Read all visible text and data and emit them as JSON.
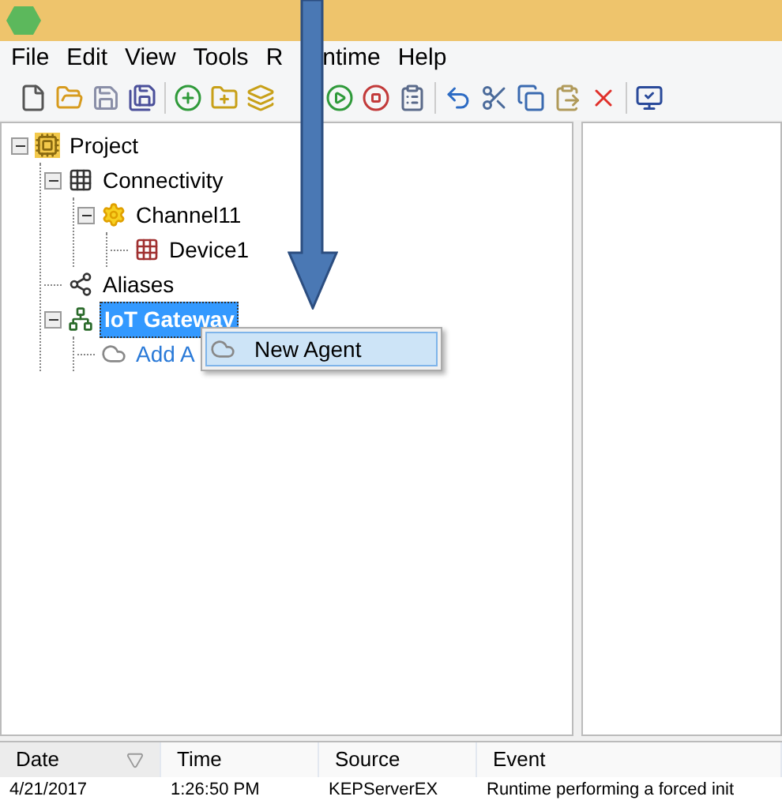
{
  "menu": [
    {
      "label": "File"
    },
    {
      "label": "Edit"
    },
    {
      "label": "View"
    },
    {
      "label": "Tools"
    },
    {
      "label": "R",
      "label_rest": "ntime"
    },
    {
      "label": "Help"
    }
  ],
  "tree": [
    {
      "label": "Project",
      "kind": "project",
      "expanded": true,
      "selected": false,
      "children": [
        {
          "label": "Connectivity",
          "kind": "connectivity",
          "expanded": true,
          "selected": false,
          "children": [
            {
              "label": "Channel11",
              "kind": "channel",
              "expanded": true,
              "selected": false,
              "children": [
                {
                  "label": "Device1",
                  "kind": "device",
                  "selected": false
                }
              ]
            }
          ]
        },
        {
          "label": "Aliases",
          "kind": "aliases",
          "selected": false
        },
        {
          "label": "IoT Gateway",
          "kind": "gateway",
          "expanded": true,
          "selected": true,
          "children": [
            {
              "label": "Add A",
              "kind": "agent",
              "selected": false
            }
          ]
        }
      ]
    }
  ],
  "context_menu": [
    {
      "label": "New Agent",
      "selected": true
    }
  ],
  "log": {
    "columns": [
      {
        "label": "Date",
        "sorted": true
      },
      {
        "label": "Time",
        "sorted": false
      },
      {
        "label": "Source",
        "sorted": false
      },
      {
        "label": "Event",
        "sorted": false
      }
    ],
    "rows": [
      [
        "4/21/2017",
        "1:26:50 PM",
        "KEPServerEX",
        "Runtime performing a forced init"
      ]
    ]
  }
}
